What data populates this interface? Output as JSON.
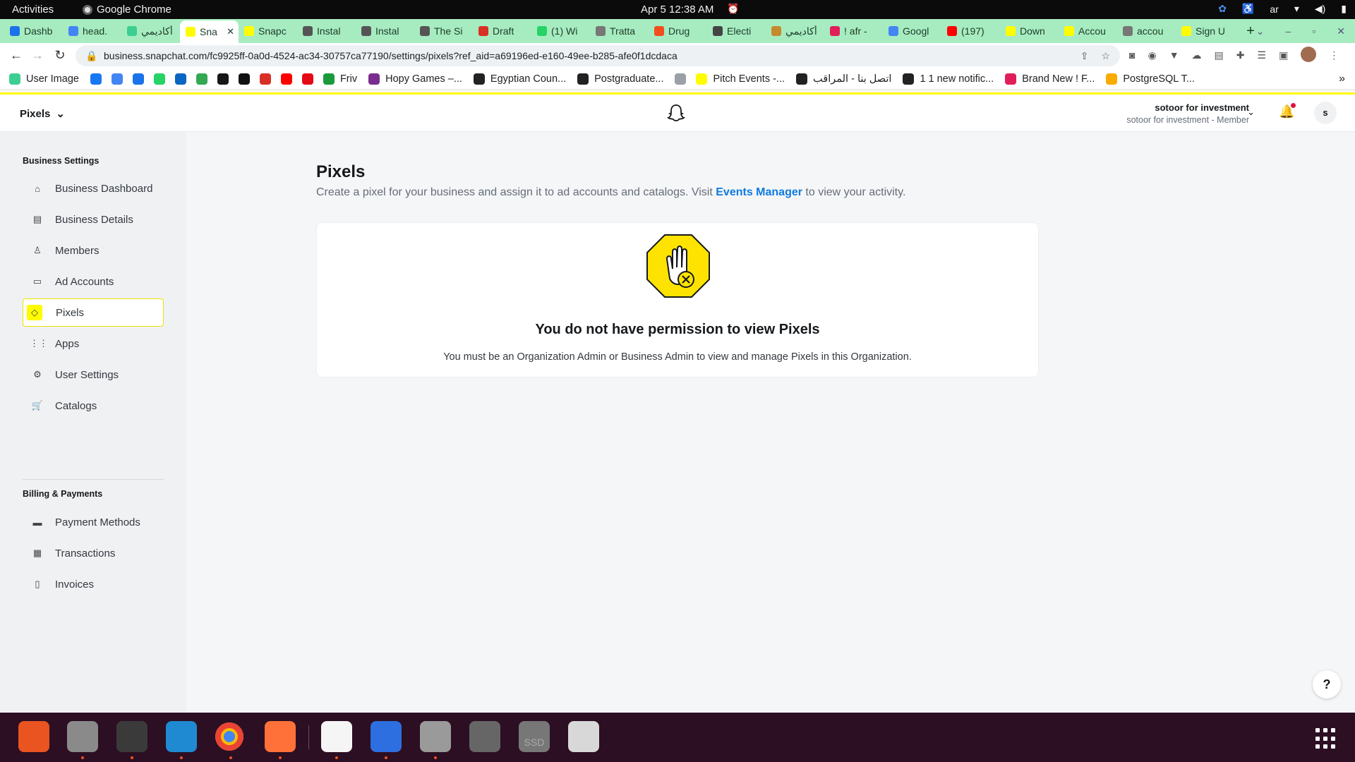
{
  "system_bar": {
    "activities": "Activities",
    "app_name": "Google Chrome",
    "clock": "Apr 5  12:38 AM",
    "lang": "ar"
  },
  "tabs": [
    {
      "label": "Dashb",
      "color": "#1a73e8"
    },
    {
      "label": "head.",
      "color": "#4285f4"
    },
    {
      "label": "أكاديمي",
      "color": "#3ccf91"
    },
    {
      "label": "Sna",
      "color": "#fffc00",
      "active": true
    },
    {
      "label": "Snapc",
      "color": "#fffc00"
    },
    {
      "label": "Instal",
      "color": "#555555"
    },
    {
      "label": "Instal",
      "color": "#555555"
    },
    {
      "label": "The Si",
      "color": "#555555"
    },
    {
      "label": "Draft",
      "color": "#d93025"
    },
    {
      "label": "(1) Wi",
      "color": "#25d366"
    },
    {
      "label": "Tratta",
      "color": "#777777"
    },
    {
      "label": "Drug",
      "color": "#f24e1e"
    },
    {
      "label": "Electi",
      "color": "#444444"
    },
    {
      "label": "أكاديمي",
      "color": "#c58a2c"
    },
    {
      "label": "! afr -",
      "color": "#e01e5a"
    },
    {
      "label": "Googl",
      "color": "#4285f4"
    },
    {
      "label": "(197)",
      "color": "#ff0000"
    },
    {
      "label": "Down",
      "color": "#fffc00"
    },
    {
      "label": "Accou",
      "color": "#fffc00"
    },
    {
      "label": "accou",
      "color": "#777777"
    },
    {
      "label": "Sign U",
      "color": "#fffc00"
    }
  ],
  "tab_close": "✕",
  "new_tab": "+",
  "address_bar": {
    "url": "business.snapchat.com/fc9925ff-0a0d-4524-ac34-30757ca77190/settings/pixels?ref_aid=a69196ed-e160-49ee-b285-afe0f1dcdaca"
  },
  "bookmarks": [
    {
      "label": "User Image",
      "color": "#3ccf91"
    },
    {
      "label": "",
      "color": "#1877f2"
    },
    {
      "label": "",
      "color": "#4285f4"
    },
    {
      "label": "",
      "color": "#1a73e8"
    },
    {
      "label": "",
      "color": "#25d366"
    },
    {
      "label": "",
      "color": "#0a66c2"
    },
    {
      "label": "",
      "color": "#34a853"
    },
    {
      "label": "",
      "color": "#181717"
    },
    {
      "label": "",
      "color": "#111111"
    },
    {
      "label": "",
      "color": "#d93025"
    },
    {
      "label": "",
      "color": "#ff0000"
    },
    {
      "label": "",
      "color": "#e50914"
    },
    {
      "label": "Friv",
      "color": "#1b9a3c"
    },
    {
      "label": "Hopy Games –...",
      "color": "#7b2d8e"
    },
    {
      "label": "Egyptian Coun...",
      "color": "#222222"
    },
    {
      "label": "Postgraduate...",
      "color": "#222222"
    },
    {
      "label": "",
      "color": "#9aa0a6"
    },
    {
      "label": "Pitch Events -...",
      "color": "#fffc00"
    },
    {
      "label": "اتصل بنا - المراقب",
      "color": "#222222"
    },
    {
      "label": "1 1 new notific...",
      "color": "#222222"
    },
    {
      "label": "Brand New ! F...",
      "color": "#e01e5a"
    },
    {
      "label": "PostgreSQL T...",
      "color": "#f9ab00"
    }
  ],
  "bookmarks_more": "»",
  "header": {
    "section": "Pixels",
    "org_name": "sotoor for investment",
    "org_role": "sotoor for investment - Member",
    "avatar_initial": "s"
  },
  "sidebar": {
    "group1": "Business Settings",
    "items1": [
      {
        "label": "Business Dashboard",
        "icon": "⌂"
      },
      {
        "label": "Business Details",
        "icon": "▤"
      },
      {
        "label": "Members",
        "icon": "♙"
      },
      {
        "label": "Ad Accounts",
        "icon": "▭"
      },
      {
        "label": "Pixels",
        "icon": "◇",
        "active": true
      },
      {
        "label": "Apps",
        "icon": "⋮⋮"
      },
      {
        "label": "User Settings",
        "icon": "⚙"
      },
      {
        "label": "Catalogs",
        "icon": "🛒"
      }
    ],
    "group2": "Billing & Payments",
    "items2": [
      {
        "label": "Payment Methods",
        "icon": "▬"
      },
      {
        "label": "Transactions",
        "icon": "▦"
      },
      {
        "label": "Invoices",
        "icon": "▯"
      }
    ]
  },
  "main": {
    "title": "Pixels",
    "desc_before": "Create a pixel for your business and assign it to ad accounts and catalogs. Visit ",
    "desc_link": "Events Manager",
    "desc_after": " to view your activity.",
    "empty_title": "You do not have permission to view Pixels",
    "empty_sub": "You must be an Organization Admin or Business Admin to view and manage Pixels in this Organization."
  },
  "help_icon": "?",
  "dock_apps": [
    {
      "name": "app-center",
      "color": "#e95420",
      "running": false
    },
    {
      "name": "files",
      "color": "#8a8a8a",
      "running": true
    },
    {
      "name": "terminal",
      "color": "#3a3a3a",
      "running": true
    },
    {
      "name": "vscode",
      "color": "#1f8ad2",
      "running": true
    },
    {
      "name": "chrome",
      "color": "#4285f4",
      "running": true
    },
    {
      "name": "firefox",
      "color": "#ff7139",
      "running": true
    },
    {
      "name": "text-editor",
      "color": "#f5f5f5",
      "running": true
    },
    {
      "name": "sync-app",
      "color": "#2d6fe0",
      "running": true
    },
    {
      "name": "settings",
      "color": "#9a9a9a",
      "running": true
    },
    {
      "name": "disk",
      "color": "#666666",
      "running": false
    },
    {
      "name": "ssd",
      "color": "#777777",
      "running": false
    },
    {
      "name": "trash",
      "color": "#d8d8d8",
      "running": false
    }
  ],
  "dock_ssd_label": "SSD"
}
